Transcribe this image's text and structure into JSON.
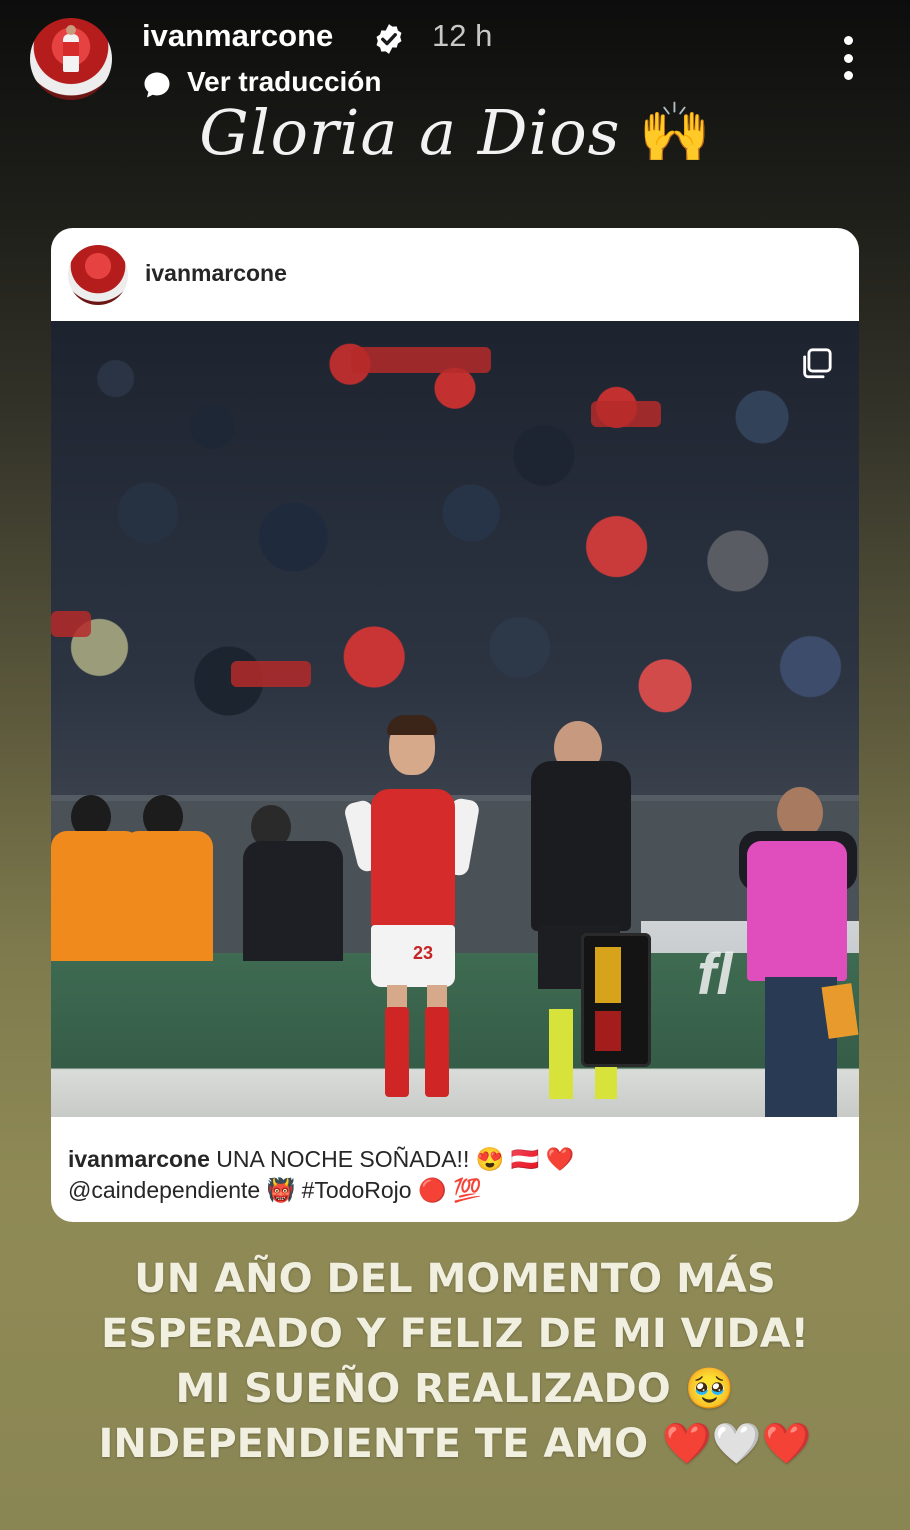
{
  "header": {
    "username": "ivanmarcone",
    "time": "12 h",
    "translate_label": "Ver traducción",
    "verified_icon": "verified-badge-icon",
    "more_icon": "more-vertical-icon"
  },
  "story_title": {
    "text": "Gloria a Dios",
    "emoji": "🙌"
  },
  "shared_post": {
    "username": "ivanmarcone",
    "player_number": "23",
    "board_ad_text": "fl",
    "carousel_icon": "carousel-icon",
    "caption_username": "ivanmarcone",
    "caption_line1": "UNA NOCHE SOÑADA!! 😍 🇦🇹 ❤️",
    "caption_line2": "@caindependiente 👹 #TodoRojo 🔴 💯"
  },
  "story_text": {
    "line1": "UN AÑO DEL MOMENTO MÁS",
    "line2": "ESPERADO Y FELIZ DE MI VIDA!",
    "line3": "MI SUEÑO REALIZADO 🥹",
    "line4": "INDEPENDIENTE TE AMO ❤️🤍❤️"
  },
  "colors": {
    "accent_red": "#d52b2b",
    "background_top": "#0d0d0d",
    "background_bottom": "#8a8654"
  }
}
